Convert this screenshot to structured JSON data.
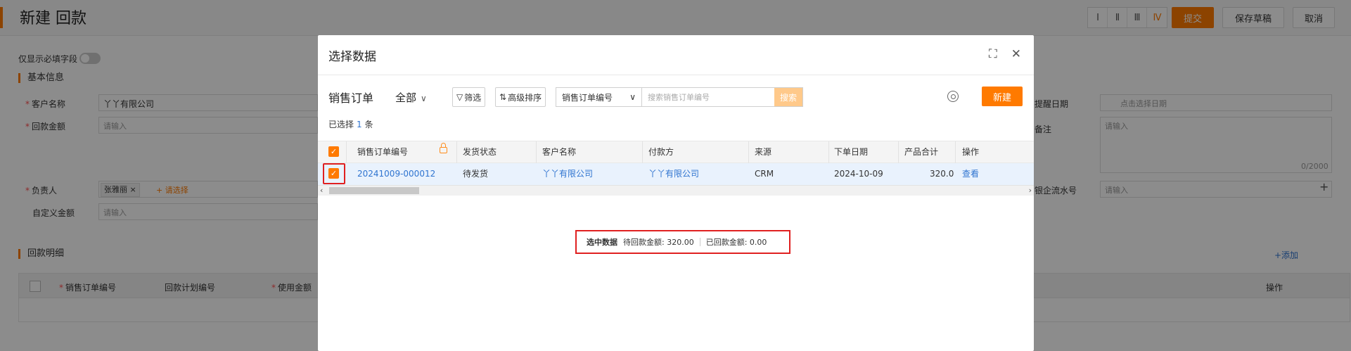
{
  "page": {
    "title": "新建 回款",
    "col_switch": [
      "Ⅰ",
      "Ⅱ",
      "Ⅲ",
      "Ⅳ"
    ],
    "submit_label": "提交",
    "save_draft_label": "保存草稿",
    "cancel_label": "取消",
    "required_only_label": "仅显示必填字段",
    "basic_info_title": "基本信息",
    "fields": {
      "customer_label": "客户名称",
      "customer_value": "丫丫有限公司",
      "amount_label": "回款金额",
      "amount_placeholder": "请输入",
      "owner_label": "负责人",
      "owner_tag": "张雅丽",
      "owner_add": "+ 请选择",
      "custom_amount_label": "自定义金额",
      "custom_amount_placeholder": "请输入",
      "remind_date_label": "提醒日期",
      "remind_date_placeholder": "点击选择日期",
      "note_label": "备注",
      "note_placeholder": "请输入",
      "note_counter": "0/2000",
      "bank_flow_label": "银企流水号",
      "bank_flow_placeholder": "请输入"
    },
    "detail_title": "回款明细",
    "detail_add": "+添加",
    "detail_headers": [
      "销售订单编号",
      "回款计划编号",
      "使用金额",
      "操作"
    ]
  },
  "modal": {
    "title": "选择数据",
    "object_name": "销售订单",
    "scope": "全部",
    "filter_label": "筛选",
    "sort_label": "高级排序",
    "search_field": "销售订单编号",
    "search_placeholder": "搜索销售订单编号",
    "search_button": "搜索",
    "new_button": "新建",
    "selected_prefix": "已选择",
    "selected_count": "1",
    "selected_suffix": "条",
    "columns": [
      "销售订单编号",
      "发货状态",
      "客户名称",
      "付款方",
      "来源",
      "下单日期",
      "产品合计",
      "操作"
    ],
    "rows": [
      {
        "order_no": "20241009-000012",
        "ship_status": "待发货",
        "customer": "丫丫有限公司",
        "payer": "丫丫有限公司",
        "source": "CRM",
        "order_date": "2024-10-09",
        "product_total": "320.0",
        "action": "查看"
      }
    ],
    "summary": {
      "title": "选中数据",
      "pending_label": "待回款金额: 320.00",
      "received_label": "已回款金额: 0.00"
    }
  },
  "colors": {
    "accent": "#ff7a00",
    "link": "#2f74d0",
    "highlight": "#e02020"
  }
}
